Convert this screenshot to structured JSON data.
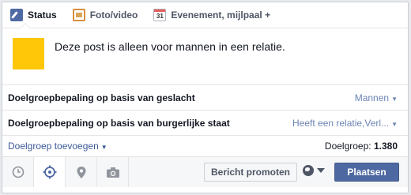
{
  "tabs": [
    {
      "label": "Status",
      "icon": "pencil-status-icon"
    },
    {
      "label": "Foto/video",
      "icon": "photo-icon"
    },
    {
      "label": "Evenement, mijlpaal +",
      "icon": "calendar-icon",
      "icon_text": "31"
    }
  ],
  "post": {
    "text": "Deze post is alleen voor mannen in een relatie."
  },
  "targeting": [
    {
      "label": "Doelgroepbepaling op basis van geslacht",
      "value": "Mannen"
    },
    {
      "label": "Doelgroepbepaling op basis van burgerlijke staat",
      "value": "Heeft een relatie,Verl..."
    }
  ],
  "audience": {
    "add_label": "Doelgroep toevoegen",
    "count_label": "Doelgroep:",
    "count_value": "1.380"
  },
  "bottom": {
    "icons": [
      "clock-icon",
      "crosshair-target-icon",
      "location-pin-icon",
      "camera-icon"
    ],
    "promote_label": "Bericht promoten",
    "privacy_icon": "globe-icon",
    "publish_label": "Plaatsen"
  },
  "colors": {
    "accent": "#4e69a2",
    "link": "#3b5998",
    "avatar": "#ffc708"
  }
}
